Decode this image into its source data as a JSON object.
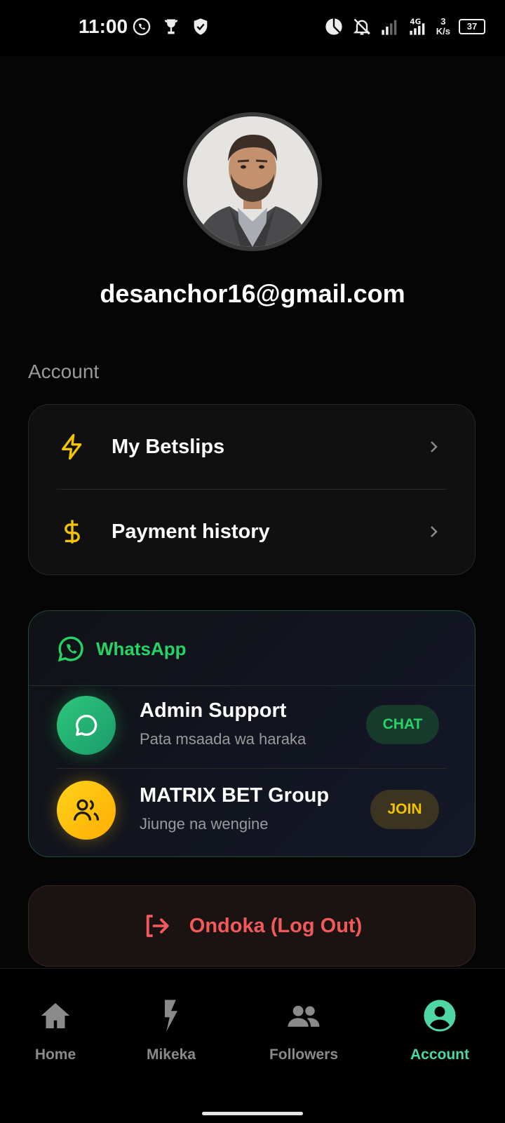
{
  "status_bar": {
    "time": "11:00",
    "network_speed": "3\nK/s",
    "network_speed_top": "3",
    "network_speed_bottom": "K/s",
    "battery": "37",
    "network_type": "4G"
  },
  "profile": {
    "email": "desanchor16@gmail.com"
  },
  "account_section": {
    "heading": "Account",
    "items": [
      {
        "label": "My Betslips",
        "icon": "lightning-icon"
      },
      {
        "label": "Payment history",
        "icon": "dollar-icon"
      }
    ]
  },
  "whatsapp": {
    "heading": "WhatsApp",
    "rows": [
      {
        "title": "Admin Support",
        "subtitle": "Pata msaada wa haraka",
        "button": "CHAT"
      },
      {
        "title": "MATRIX BET Group",
        "subtitle": "Jiunge na wengine",
        "button": "JOIN"
      }
    ]
  },
  "logout": {
    "label": "Ondoka (Log Out)"
  },
  "bottom_nav": {
    "items": [
      {
        "label": "Home"
      },
      {
        "label": "Mikeka"
      },
      {
        "label": "Followers"
      },
      {
        "label": "Account"
      }
    ],
    "active": "Account"
  },
  "colors": {
    "accent_green": "#25d366",
    "active_nav": "#4fd6a5",
    "yellow": "#f5c400",
    "logout_red": "#f25a5a"
  }
}
